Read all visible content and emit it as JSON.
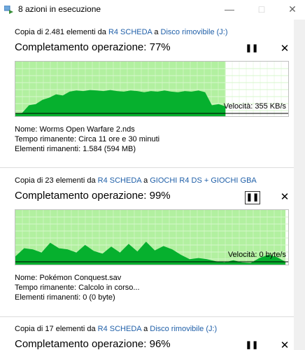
{
  "window": {
    "title": "8 azioni in esecuzione",
    "minimize_icon": "minimize-icon",
    "maximize_icon": "maximize-icon",
    "close_icon": "close-icon"
  },
  "colors": {
    "link": "#1f5fa8",
    "progress_fill": "#b2f0a0",
    "graph_fill": "#06b02e",
    "grid": "#ffffff"
  },
  "operations": [
    {
      "source_prefix": "Copia di 2.481 elementi da",
      "source": "R4 SCHEDA",
      "connector": "a",
      "destination": "Disco rimovibile (J:)",
      "progress_label": "Completamento operazione: 77%",
      "progress": 0.77,
      "pause_icon": "pause-icon",
      "cancel_icon": "close-icon",
      "speed_label": "Velocità: 355 KB/s",
      "name_label": "Nome:",
      "name_value": "Worms Open Warfare 2.nds",
      "time_label": "Tempo rimanente:",
      "time_value": "Circa 11 ore e 30 minuti",
      "items_label": "Elementi rimanenti:",
      "items_value": "1.584 (594 MB)",
      "graph": [
        0.05,
        0.06,
        0.2,
        0.22,
        0.3,
        0.34,
        0.4,
        0.38,
        0.45,
        0.47,
        0.46,
        0.48,
        0.47,
        0.46,
        0.48,
        0.46,
        0.45,
        0.47,
        0.46,
        0.44,
        0.46,
        0.45,
        0.47,
        0.45,
        0.44,
        0.46,
        0.45,
        0.47,
        0.44,
        0.2,
        0.22,
        0.18
      ]
    },
    {
      "source_prefix": "Copia di 23 elementi da",
      "source": "R4 SCHEDA",
      "connector": "a",
      "destination": "GIOCHI R4 DS + GIOCHI GBA",
      "progress_label": "Completamento operazione: 99%",
      "progress": 0.99,
      "pause_icon": "pause-icon",
      "cancel_icon": "close-icon",
      "speed_label": "Velocità: 0 byte/s",
      "name_label": "Nome:",
      "name_value": "Pokémon Conquest.sav",
      "time_label": "Tempo rimanente:",
      "time_value": "Calcolo in corso...",
      "items_label": "Elementi rimanenti:",
      "items_value": "0 (0 byte)",
      "graph": [
        0.15,
        0.3,
        0.28,
        0.22,
        0.4,
        0.3,
        0.28,
        0.22,
        0.36,
        0.25,
        0.2,
        0.33,
        0.22,
        0.38,
        0.24,
        0.42,
        0.26,
        0.34,
        0.28,
        0.18,
        0.1,
        0.12,
        0.1,
        0.06,
        0.04,
        0.08,
        0.04,
        0.03,
        0.12,
        0.18,
        0.14,
        0.05
      ]
    },
    {
      "source_prefix": "Copia di 17 elementi da",
      "source": "R4 SCHEDA",
      "connector": "a",
      "destination": "Disco rimovibile (J:)",
      "progress_label": "Completamento operazione: 96%",
      "pause_icon": "pause-icon",
      "cancel_icon": "close-icon"
    }
  ]
}
